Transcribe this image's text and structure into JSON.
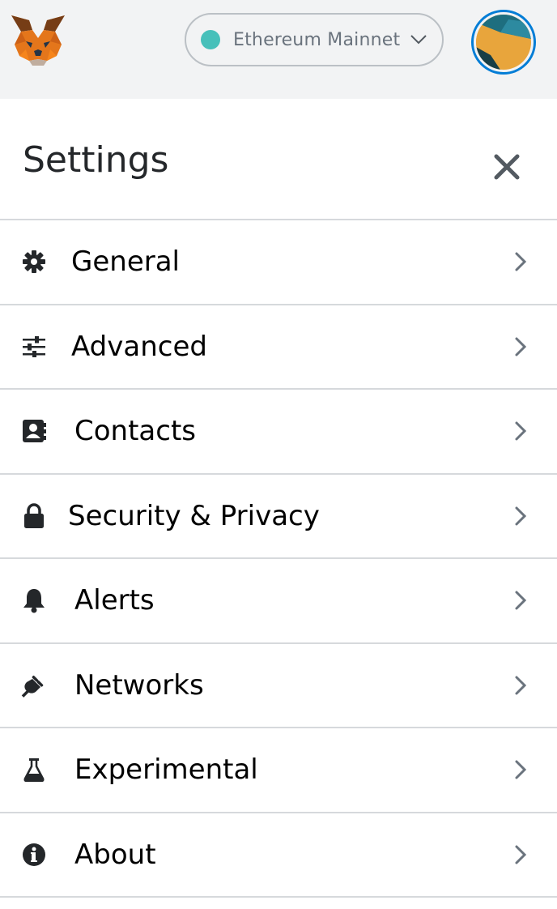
{
  "topbar": {
    "logo_icon": "metamask-fox-icon",
    "network": {
      "label": "Ethereum Mainnet",
      "dot_color": "#29b6af"
    },
    "account_icon": "account-identicon-icon"
  },
  "settings": {
    "title": "Settings",
    "close_icon": "close-icon",
    "items": [
      {
        "label": "General",
        "icon": "gear-icon"
      },
      {
        "label": "Advanced",
        "icon": "sliders-icon"
      },
      {
        "label": "Contacts",
        "icon": "contact-book-icon"
      },
      {
        "label": "Security & Privacy",
        "icon": "lock-icon"
      },
      {
        "label": "Alerts",
        "icon": "bell-icon"
      },
      {
        "label": "Networks",
        "icon": "plug-icon"
      },
      {
        "label": "Experimental",
        "icon": "flask-icon"
      },
      {
        "label": "About",
        "icon": "info-icon"
      }
    ]
  },
  "colors": {
    "accent": "#037dd6",
    "topbar_bg": "#f2f3f4",
    "divider": "#d6d9dc"
  }
}
